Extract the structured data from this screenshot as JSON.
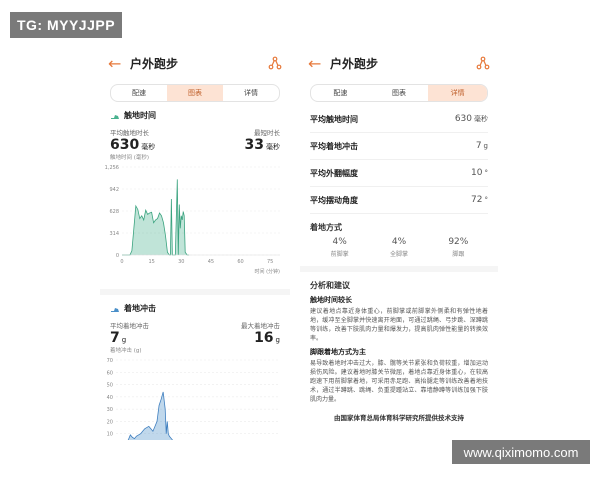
{
  "watermark_top": "TG: MYYJJPP",
  "watermark_bottom": "www.qiximomo.com",
  "left": {
    "title": "户外跑步",
    "tabs": [
      "配速",
      "图表",
      "详情"
    ],
    "active_tab": 1,
    "contact": {
      "title": "触地时间",
      "avg_label": "平均触地时长",
      "avg_value": "630",
      "avg_unit": "毫秒",
      "min_label": "最短时长",
      "min_value": "33",
      "min_unit": "毫秒",
      "unit_label": "触地时间 (毫秒)"
    },
    "impact": {
      "title": "着地冲击",
      "avg_label": "平均着地冲击",
      "avg_value": "7",
      "avg_unit": "g",
      "max_label": "最大着地冲击",
      "max_value": "16",
      "max_unit": "g",
      "unit_label": "着地冲击 (g)"
    }
  },
  "right": {
    "title": "户外跑步",
    "tabs": [
      "配速",
      "图表",
      "详情"
    ],
    "active_tab": 2,
    "metrics": [
      {
        "label": "平均触地时间",
        "value": "630",
        "unit": "毫秒"
      },
      {
        "label": "平均着地冲击",
        "value": "7",
        "unit": "g"
      },
      {
        "label": "平均外翻幅度",
        "value": "10",
        "unit": "°"
      },
      {
        "label": "平均摆动角度",
        "value": "72",
        "unit": "°"
      }
    ],
    "strike_title": "着地方式",
    "strike": [
      {
        "pct": "4%",
        "label": "前脚掌"
      },
      {
        "pct": "4%",
        "label": "全脚掌"
      },
      {
        "pct": "92%",
        "label": "脚跟"
      }
    ],
    "analysis_title": "分析和建议",
    "s1_title": "触地时间较长",
    "s1_text": "建议着地点靠近身体重心，前脚掌或前脚掌外侧柔和有弹性地着地，缓冲至全脚掌并快速离开地面，可通过跳绳、弓步跳、深蹲跳等训练，改善下肢肌肉力量和爆发力，提高肌肉弹性能量的转换效率。",
    "s2_title": "脚跟着地方式为主",
    "s2_text": "易导致着地时冲击过大，膝、髋等关节紧张和负荷较重，增加运动损伤风险。建议着地时膝关节微屈，着地点靠近身体重心，在较高跑速下用前脚掌着地，可采用赤足跑、高抬腿走等训练改善着地技术，通过半蹲跳、跳绳、负重提踵站立、靠墙静蹲等训练加强下肢肌肉力量。",
    "footer": "由国家体育总局体育科学研究所提供技术支持"
  },
  "chart_data": [
    {
      "type": "area",
      "title": "",
      "xlabel": "时间 (分钟)",
      "ylabel": "触地时间 (毫秒)",
      "xlim": [
        0,
        80
      ],
      "ylim": [
        0,
        1256
      ],
      "x_ticks": [
        0,
        15,
        30,
        45,
        60,
        75
      ],
      "y_ticks": [
        0,
        314,
        628,
        942,
        1256
      ],
      "y_tick_labels": [
        "0",
        "314",
        "628",
        "942",
        "1,256"
      ],
      "x": [
        0,
        2,
        4,
        5,
        6,
        7,
        8,
        9,
        10,
        11,
        12,
        13,
        14,
        15,
        16,
        17,
        18,
        19,
        20,
        21,
        22,
        23,
        24,
        24.5,
        25,
        25.5,
        26,
        27,
        28,
        28.5,
        29,
        29.5,
        30,
        30.5,
        31,
        31.5,
        32,
        33,
        34
      ],
      "values": [
        0,
        0,
        0,
        60,
        380,
        700,
        650,
        520,
        560,
        500,
        640,
        580,
        600,
        610,
        460,
        500,
        520,
        600,
        560,
        460,
        280,
        40,
        0,
        0,
        800,
        0,
        0,
        0,
        1080,
        0,
        720,
        380,
        560,
        500,
        620,
        560,
        40,
        0,
        0
      ]
    },
    {
      "type": "area",
      "title": "",
      "xlabel": "",
      "ylabel": "着地冲击 (g)",
      "ylim": [
        0,
        70
      ],
      "y_ticks": [
        0,
        10,
        20,
        30,
        40,
        50,
        60,
        70
      ],
      "x": [
        0,
        2,
        4,
        5,
        6,
        7,
        8,
        9,
        10,
        11,
        12,
        13,
        14,
        15,
        16,
        17,
        18,
        19,
        20,
        21,
        22,
        23,
        24,
        24.5,
        25,
        25.5,
        26,
        27,
        28,
        28.5,
        29,
        29.5,
        30,
        30.5,
        31,
        31.5,
        32,
        33,
        34
      ],
      "values": [
        0,
        0,
        0,
        2,
        5,
        9,
        7,
        6,
        8,
        9,
        10,
        12,
        14,
        15,
        16,
        14,
        12,
        16,
        20,
        33,
        38,
        44,
        30,
        10,
        20,
        10,
        8,
        6,
        4,
        2,
        1,
        0,
        0,
        0,
        0,
        0,
        0,
        0,
        0
      ]
    }
  ]
}
